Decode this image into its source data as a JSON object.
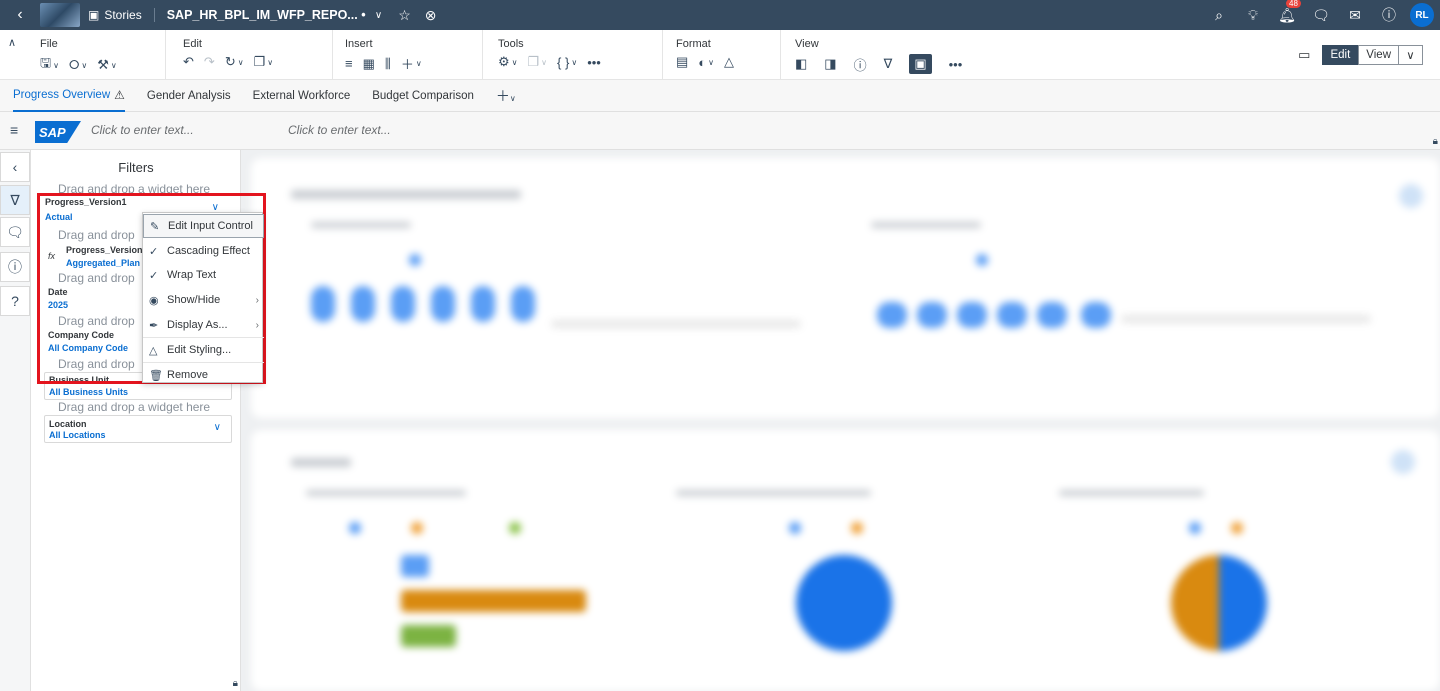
{
  "shell": {
    "stories_label": "Stories",
    "story_title": "SAP_HR_BPL_IM_WFP_REPO... •",
    "notification_count": "48",
    "user_initials": "RL"
  },
  "toolbar": {
    "groups": {
      "file": "File",
      "edit": "Edit",
      "insert": "Insert",
      "tools": "Tools",
      "format": "Format",
      "view": "View"
    },
    "mode_edit": "Edit",
    "mode_view": "View"
  },
  "tabs": [
    {
      "label": "Progress Overview"
    },
    {
      "label": "Gender Analysis"
    },
    {
      "label": "External Workforce"
    },
    {
      "label": "Budget Comparison"
    }
  ],
  "header": {
    "logo_text": "SAP",
    "placeholder_left": "Click to enter text...",
    "placeholder_right": "Click to enter text..."
  },
  "filters": {
    "title": "Filters",
    "drop_hint": "Drag and drop a widget here",
    "drop_hint_short": "Drag and drop",
    "items": [
      {
        "name": "Progress_Version1",
        "value": "Actual"
      },
      {
        "name": "Progress_Version",
        "value": "Aggregated_Plan"
      },
      {
        "name": "Date",
        "value": "2025"
      },
      {
        "name": "Company Code",
        "value": "All Company Code"
      },
      {
        "name": "Business Unit",
        "value": "All Business Units"
      },
      {
        "name": "Location",
        "value": "All Locations"
      }
    ]
  },
  "context_menu": {
    "items": [
      {
        "label": "Edit Input Control",
        "icon": "pencil-icon"
      },
      {
        "label": "Cascading Effect",
        "icon": "checkmark-icon"
      },
      {
        "label": "Wrap Text",
        "icon": "checkmark-icon"
      },
      {
        "label": "Show/Hide",
        "icon": "eye-icon"
      },
      {
        "label": "Display As...",
        "icon": "paint-icon"
      },
      {
        "label": "Edit Styling...",
        "icon": "styling-icon"
      },
      {
        "label": "Remove",
        "icon": "trash-icon"
      }
    ]
  },
  "colors": {
    "shell_bg": "#354a5f",
    "accent": "#0a6ed1",
    "highlight_border": "#e3141e"
  }
}
